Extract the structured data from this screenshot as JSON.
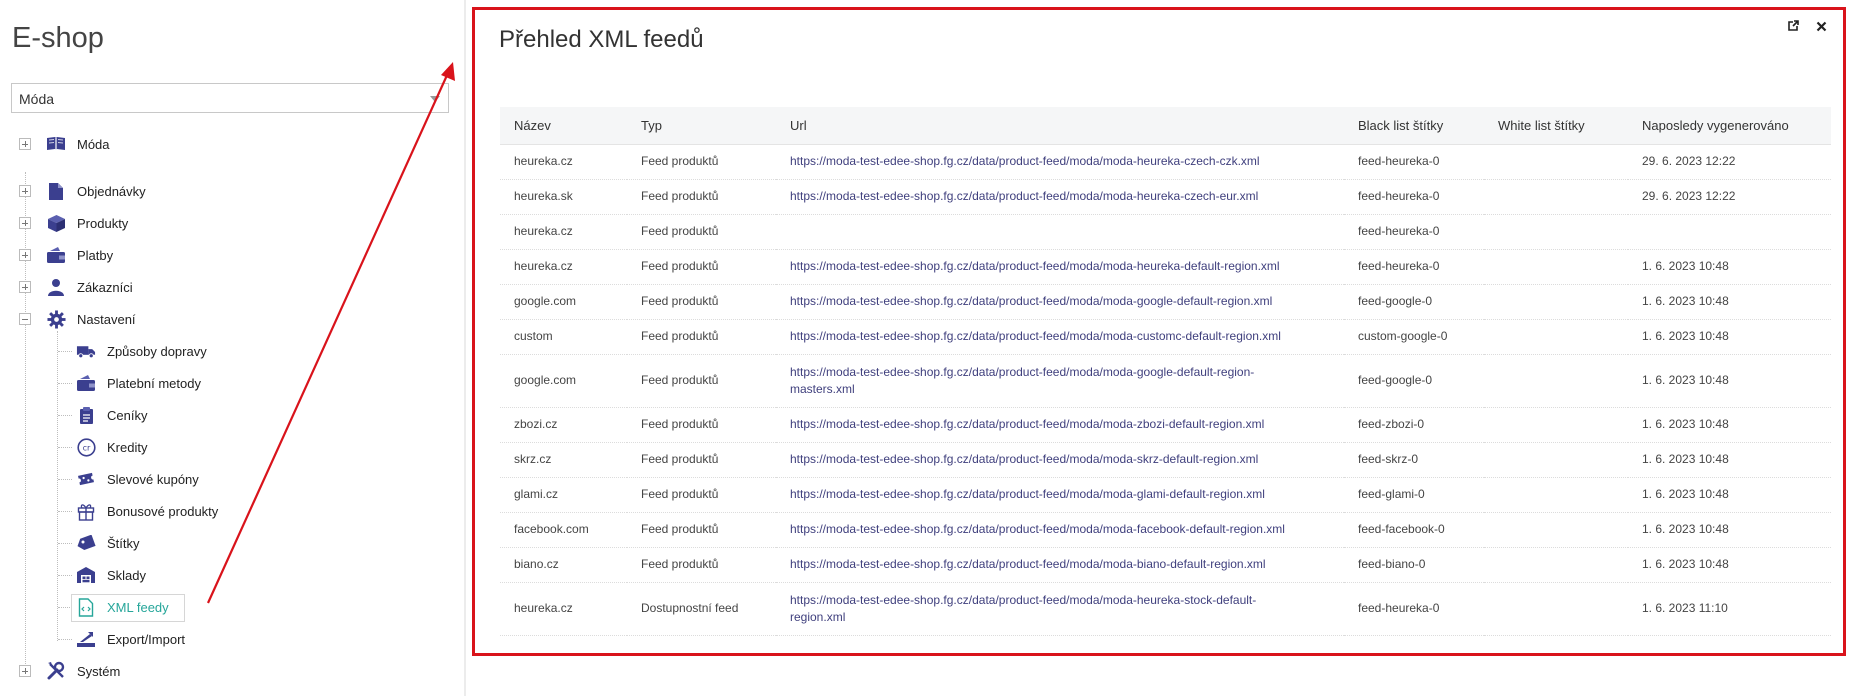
{
  "app": {
    "title": "E-shop"
  },
  "shop_select": {
    "value": "Móda"
  },
  "tree": {
    "root": "Móda",
    "items": [
      {
        "label": "Objednávky",
        "icon": "file-icon"
      },
      {
        "label": "Produkty",
        "icon": "box-icon"
      },
      {
        "label": "Platby",
        "icon": "wallet-icon"
      },
      {
        "label": "Zákazníci",
        "icon": "user-icon"
      },
      {
        "label": "Nastavení",
        "icon": "gear-icon"
      }
    ],
    "settings_children": [
      {
        "label": "Způsoby dopravy",
        "icon": "truck-icon"
      },
      {
        "label": "Platební metody",
        "icon": "wallet-icon"
      },
      {
        "label": "Ceníky",
        "icon": "clipboard-icon"
      },
      {
        "label": "Kredity",
        "icon": "credit-icon"
      },
      {
        "label": "Slevové kupóny",
        "icon": "coupon-icon"
      },
      {
        "label": "Bonusové produkty",
        "icon": "gift-icon"
      },
      {
        "label": "Štítky",
        "icon": "tag-icon"
      },
      {
        "label": "Sklady",
        "icon": "warehouse-icon"
      },
      {
        "label": "XML feedy",
        "icon": "xml-file-icon"
      },
      {
        "label": "Export/Import",
        "icon": "export-icon"
      }
    ],
    "system": {
      "label": "Systém",
      "icon": "tools-icon"
    }
  },
  "panel": {
    "title": "Přehled XML feedů",
    "columns": [
      "Název",
      "Typ",
      "Url",
      "Black list štítky",
      "White list štítky",
      "Naposledy vygenerováno"
    ],
    "rows": [
      {
        "name": "heureka.cz",
        "type": "Feed produktů",
        "url": "https://moda-test-edee-shop.fg.cz/data/product-feed/moda/moda-heureka-czech-czk.xml",
        "black": "feed-heureka-0",
        "white": "",
        "generated": "29. 6. 2023 12:22"
      },
      {
        "name": "heureka.sk",
        "type": "Feed produktů",
        "url": "https://moda-test-edee-shop.fg.cz/data/product-feed/moda/moda-heureka-czech-eur.xml",
        "black": "feed-heureka-0",
        "white": "",
        "generated": "29. 6. 2023 12:22"
      },
      {
        "name": "heureka.cz",
        "type": "Feed produktů",
        "url": "",
        "black": "feed-heureka-0",
        "white": "",
        "generated": ""
      },
      {
        "name": "heureka.cz",
        "type": "Feed produktů",
        "url": "https://moda-test-edee-shop.fg.cz/data/product-feed/moda/moda-heureka-default-region.xml",
        "black": "feed-heureka-0",
        "white": "",
        "generated": "1. 6. 2023 10:48"
      },
      {
        "name": "google.com",
        "type": "Feed produktů",
        "url": "https://moda-test-edee-shop.fg.cz/data/product-feed/moda/moda-google-default-region.xml",
        "black": "feed-google-0",
        "white": "",
        "generated": "1. 6. 2023 10:48"
      },
      {
        "name": "custom",
        "type": "Feed produktů",
        "url": "https://moda-test-edee-shop.fg.cz/data/product-feed/moda/moda-customc-default-region.xml",
        "black": "custom-google-0",
        "white": "",
        "generated": "1. 6. 2023 10:48"
      },
      {
        "name": "google.com",
        "type": "Feed produktů",
        "url": "https://moda-test-edee-shop.fg.cz/data/product-feed/moda/moda-google-default-region-masters.xml",
        "black": "feed-google-0",
        "white": "",
        "generated": "1. 6. 2023 10:48"
      },
      {
        "name": "zbozi.cz",
        "type": "Feed produktů",
        "url": "https://moda-test-edee-shop.fg.cz/data/product-feed/moda/moda-zbozi-default-region.xml",
        "black": "feed-zbozi-0",
        "white": "",
        "generated": "1. 6. 2023 10:48"
      },
      {
        "name": "skrz.cz",
        "type": "Feed produktů",
        "url": "https://moda-test-edee-shop.fg.cz/data/product-feed/moda/moda-skrz-default-region.xml",
        "black": "feed-skrz-0",
        "white": "",
        "generated": "1. 6. 2023 10:48"
      },
      {
        "name": "glami.cz",
        "type": "Feed produktů",
        "url": "https://moda-test-edee-shop.fg.cz/data/product-feed/moda/moda-glami-default-region.xml",
        "black": "feed-glami-0",
        "white": "",
        "generated": "1. 6. 2023 10:48"
      },
      {
        "name": "facebook.com",
        "type": "Feed produktů",
        "url": "https://moda-test-edee-shop.fg.cz/data/product-feed/moda/moda-facebook-default-region.xml",
        "black": "feed-facebook-0",
        "white": "",
        "generated": "1. 6. 2023 10:48"
      },
      {
        "name": "biano.cz",
        "type": "Feed produktů",
        "url": "https://moda-test-edee-shop.fg.cz/data/product-feed/moda/moda-biano-default-region.xml",
        "black": "feed-biano-0",
        "white": "",
        "generated": "1. 6. 2023 10:48"
      },
      {
        "name": "heureka.cz",
        "type": "Dostupnostní feed",
        "url": "https://moda-test-edee-shop.fg.cz/data/product-feed/moda/moda-heureka-stock-default-region.xml",
        "black": "feed-heureka-0",
        "white": "",
        "generated": "1. 6. 2023 11:10"
      }
    ]
  },
  "colors": {
    "accent": "#26a69a",
    "highlight": "#d9131b",
    "icon": "#3b3f8f",
    "link": "#3f3f7d"
  }
}
